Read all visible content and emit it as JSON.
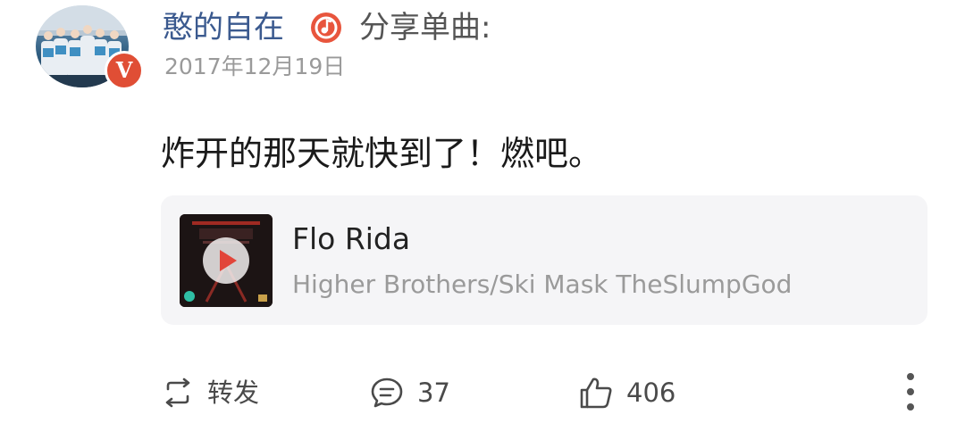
{
  "post": {
    "author": "憨的自在",
    "action_label": "分享单曲:",
    "date": "2017年12月19日",
    "verified_badge": "V",
    "text": "炸开的那天就快到了！燃吧。"
  },
  "music_card": {
    "title": "Flo Rida",
    "artist": "Higher Brothers/Ski Mask TheSlumpGod",
    "cover_icon": "play-icon"
  },
  "actions": {
    "repost_label": "转发",
    "comment_count": "37",
    "like_count": "406"
  },
  "colors": {
    "author_name": "#3b5a8f",
    "verified_badge": "#e04e35",
    "music_badge": "#e8553d",
    "card_background": "#f5f5f7",
    "secondary_text": "#9a9a9a"
  },
  "icons": {
    "music": "music-note-icon",
    "repost": "repost-icon",
    "comment": "comment-icon",
    "like": "thumbs-up-icon",
    "more": "more-vertical-icon"
  }
}
